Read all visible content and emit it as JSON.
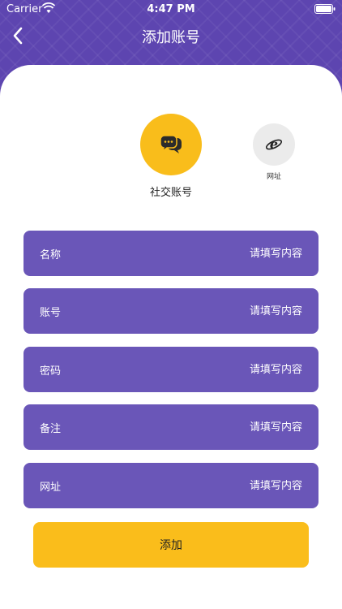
{
  "status_bar": {
    "carrier": "Carrier",
    "time": "4:47 PM"
  },
  "nav": {
    "title": "添加账号",
    "back_icon": "chevron-left-icon"
  },
  "categories": [
    {
      "label": "社交账号",
      "icon": "chat-bubbles-icon",
      "color": "#f9bd1b"
    },
    {
      "label": "网址",
      "icon": "ie-browser-icon",
      "color": "#ebebeb"
    }
  ],
  "form": {
    "fields": [
      {
        "label": "名称",
        "placeholder": "请填写内容"
      },
      {
        "label": "账号",
        "placeholder": "请填写内容"
      },
      {
        "label": "密码",
        "placeholder": "请填写内容"
      },
      {
        "label": "备注",
        "placeholder": "请填写内容"
      },
      {
        "label": "网址",
        "placeholder": "请填写内容"
      }
    ],
    "submit_label": "添加"
  },
  "colors": {
    "header": "#5d45b0",
    "field": "#6a56b8",
    "accent": "#fabd1b"
  }
}
